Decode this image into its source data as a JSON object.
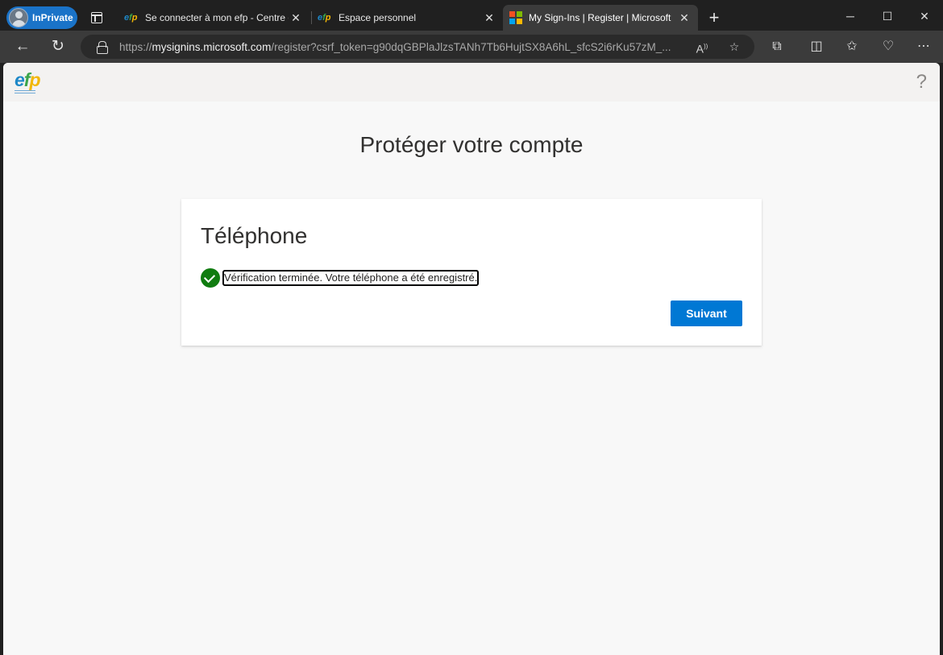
{
  "browser": {
    "inprivate_label": "InPrivate",
    "tabs": [
      {
        "title": "Se connecter à mon efp - Centre d",
        "favicon": "efp"
      },
      {
        "title": "Espace personnel",
        "favicon": "efp"
      },
      {
        "title": "My Sign-Ins | Register | Microsoft",
        "favicon": "microsoft-logo"
      }
    ],
    "address": {
      "scheme": "https://",
      "host": "mysignins.microsoft.com",
      "path": "/register?csrf_token=g90dqGBPlaJlzsTANh7Tb6HujtSX8A6hL_sfcS2i6rKu57zM_..."
    }
  },
  "page": {
    "logo_text": "efp",
    "help_glyph": "?",
    "title": "Protéger votre compte",
    "card": {
      "heading": "Téléphone",
      "status": "Vérification terminée. Votre téléphone a été enregistré.",
      "next_label": "Suivant"
    }
  },
  "colors": {
    "accent": "#0078d4",
    "success": "#107c10",
    "inprivate": "#1a73c8"
  }
}
